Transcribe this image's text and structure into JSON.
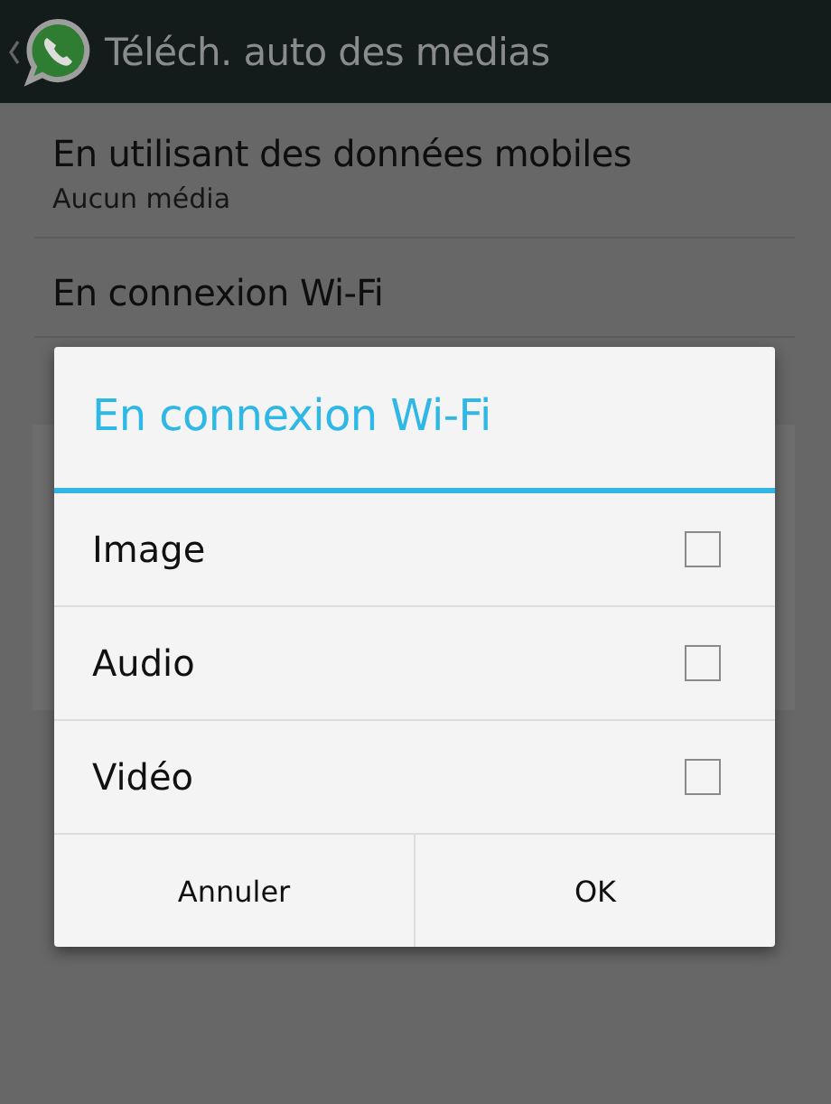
{
  "app_bar": {
    "title": "Téléch. auto des medias"
  },
  "settings": [
    {
      "title": "En utilisant des données mobiles",
      "subtitle": "Aucun média"
    },
    {
      "title": "En connexion Wi-Fi"
    }
  ],
  "dialog": {
    "title": "En connexion Wi-Fi",
    "options": [
      {
        "label": "Image",
        "checked": false
      },
      {
        "label": "Audio",
        "checked": false
      },
      {
        "label": "Vidéo",
        "checked": false
      }
    ],
    "buttons": [
      "Annuler",
      "OK"
    ]
  }
}
